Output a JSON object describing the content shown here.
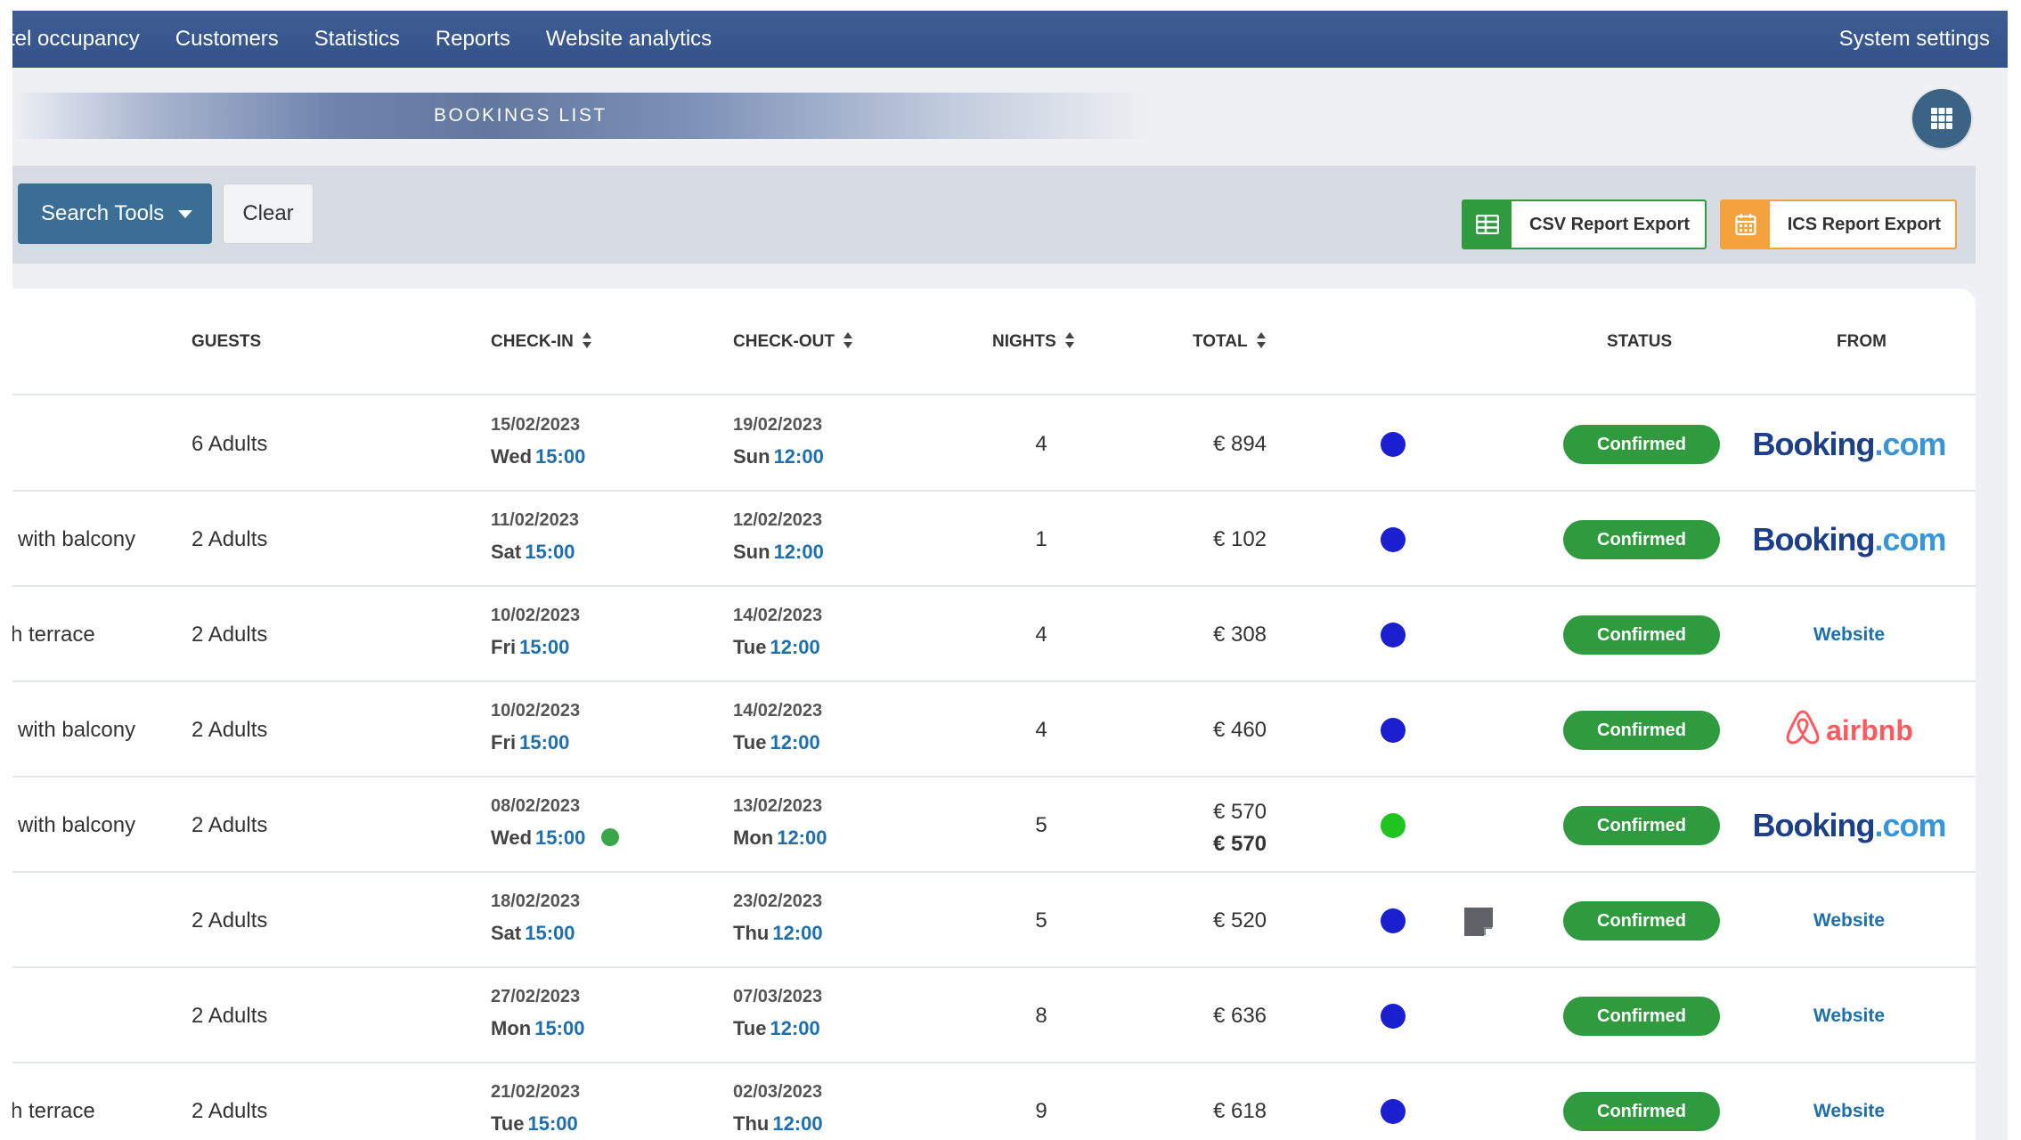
{
  "nav": {
    "items": [
      "tel occupancy",
      "Customers",
      "Statistics",
      "Reports",
      "Website analytics"
    ],
    "settings": "System settings"
  },
  "banner": {
    "title": "BOOKINGS LIST"
  },
  "toolbar": {
    "search_tools": "Search Tools",
    "clear": "Clear",
    "csv_export": "CSV Report Export",
    "ics_export": "ICS Report Export"
  },
  "table": {
    "headers": {
      "guests": "GUESTS",
      "checkin": "CHECK-IN",
      "checkout": "CHECK-OUT",
      "nights": "NIGHTS",
      "total": "TOTAL",
      "status": "STATUS",
      "from": "FROM"
    },
    "rows": [
      {
        "room": "",
        "guests": "6 Adults",
        "in_date": "15/02/2023",
        "in_day": "Wed",
        "in_time": "15:00",
        "out_date": "19/02/2023",
        "out_day": "Sun",
        "out_time": "12:00",
        "nights": "4",
        "total": "€ 894",
        "total2": "",
        "dot": "#1a1fd0",
        "note": false,
        "status": "Confirmed",
        "from": "booking"
      },
      {
        "room": "with balcony",
        "guests": "2 Adults",
        "in_date": "11/02/2023",
        "in_day": "Sat",
        "in_time": "15:00",
        "out_date": "12/02/2023",
        "out_day": "Sun",
        "out_time": "12:00",
        "nights": "1",
        "total": "€ 102",
        "total2": "",
        "dot": "#1a1fd0",
        "note": false,
        "status": "Confirmed",
        "from": "booking"
      },
      {
        "room": "h terrace",
        "guests": "2 Adults",
        "in_date": "10/02/2023",
        "in_day": "Fri",
        "in_time": "15:00",
        "out_date": "14/02/2023",
        "out_day": "Tue",
        "out_time": "12:00",
        "nights": "4",
        "total": "€ 308",
        "total2": "",
        "dot": "#1a1fd0",
        "note": false,
        "status": "Confirmed",
        "from": "website"
      },
      {
        "room": "with balcony",
        "guests": "2 Adults",
        "in_date": "10/02/2023",
        "in_day": "Fri",
        "in_time": "15:00",
        "out_date": "14/02/2023",
        "out_day": "Tue",
        "out_time": "12:00",
        "nights": "4",
        "total": "€ 460",
        "total2": "",
        "dot": "#1a1fd0",
        "note": false,
        "status": "Confirmed",
        "from": "airbnb"
      },
      {
        "room": "with balcony",
        "guests": "2 Adults",
        "in_date": "08/02/2023",
        "in_day": "Wed",
        "in_time": "15:00",
        "out_date": "13/02/2023",
        "out_day": "Mon",
        "out_time": "12:00",
        "nights": "5",
        "total": "€ 570",
        "total2": "€ 570",
        "dot": "#1fc41f",
        "note": false,
        "status": "Confirmed",
        "from": "booking",
        "checkin_indicator": "#3aa64a"
      },
      {
        "room": "",
        "guests": "2 Adults",
        "in_date": "18/02/2023",
        "in_day": "Sat",
        "in_time": "15:00",
        "out_date": "23/02/2023",
        "out_day": "Thu",
        "out_time": "12:00",
        "nights": "5",
        "total": "€ 520",
        "total2": "",
        "dot": "#1a1fd0",
        "note": true,
        "status": "Confirmed",
        "from": "website"
      },
      {
        "room": "",
        "guests": "2 Adults",
        "in_date": "27/02/2023",
        "in_day": "Mon",
        "in_time": "15:00",
        "out_date": "07/03/2023",
        "out_day": "Tue",
        "out_time": "12:00",
        "nights": "8",
        "total": "€ 636",
        "total2": "",
        "dot": "#1a1fd0",
        "note": false,
        "status": "Confirmed",
        "from": "website"
      },
      {
        "room": "h terrace",
        "guests": "2 Adults",
        "in_date": "21/02/2023",
        "in_day": "Tue",
        "in_time": "15:00",
        "out_date": "02/03/2023",
        "out_day": "Thu",
        "out_time": "12:00",
        "nights": "9",
        "total": "€ 618",
        "total2": "",
        "dot": "#1a1fd0",
        "note": false,
        "status": "Confirmed",
        "from": "website"
      }
    ]
  },
  "sources": {
    "booking_name": "Booking",
    "booking_tld": ".com",
    "website": "Website",
    "airbnb": "airbnb"
  },
  "colors": {
    "nav": "#33528a",
    "primary_button": "#3b6e94",
    "status_confirmed": "#2f9a3e",
    "csv": "#2f9a3e",
    "ics": "#f4a23c",
    "time_link": "#1e6fae"
  }
}
